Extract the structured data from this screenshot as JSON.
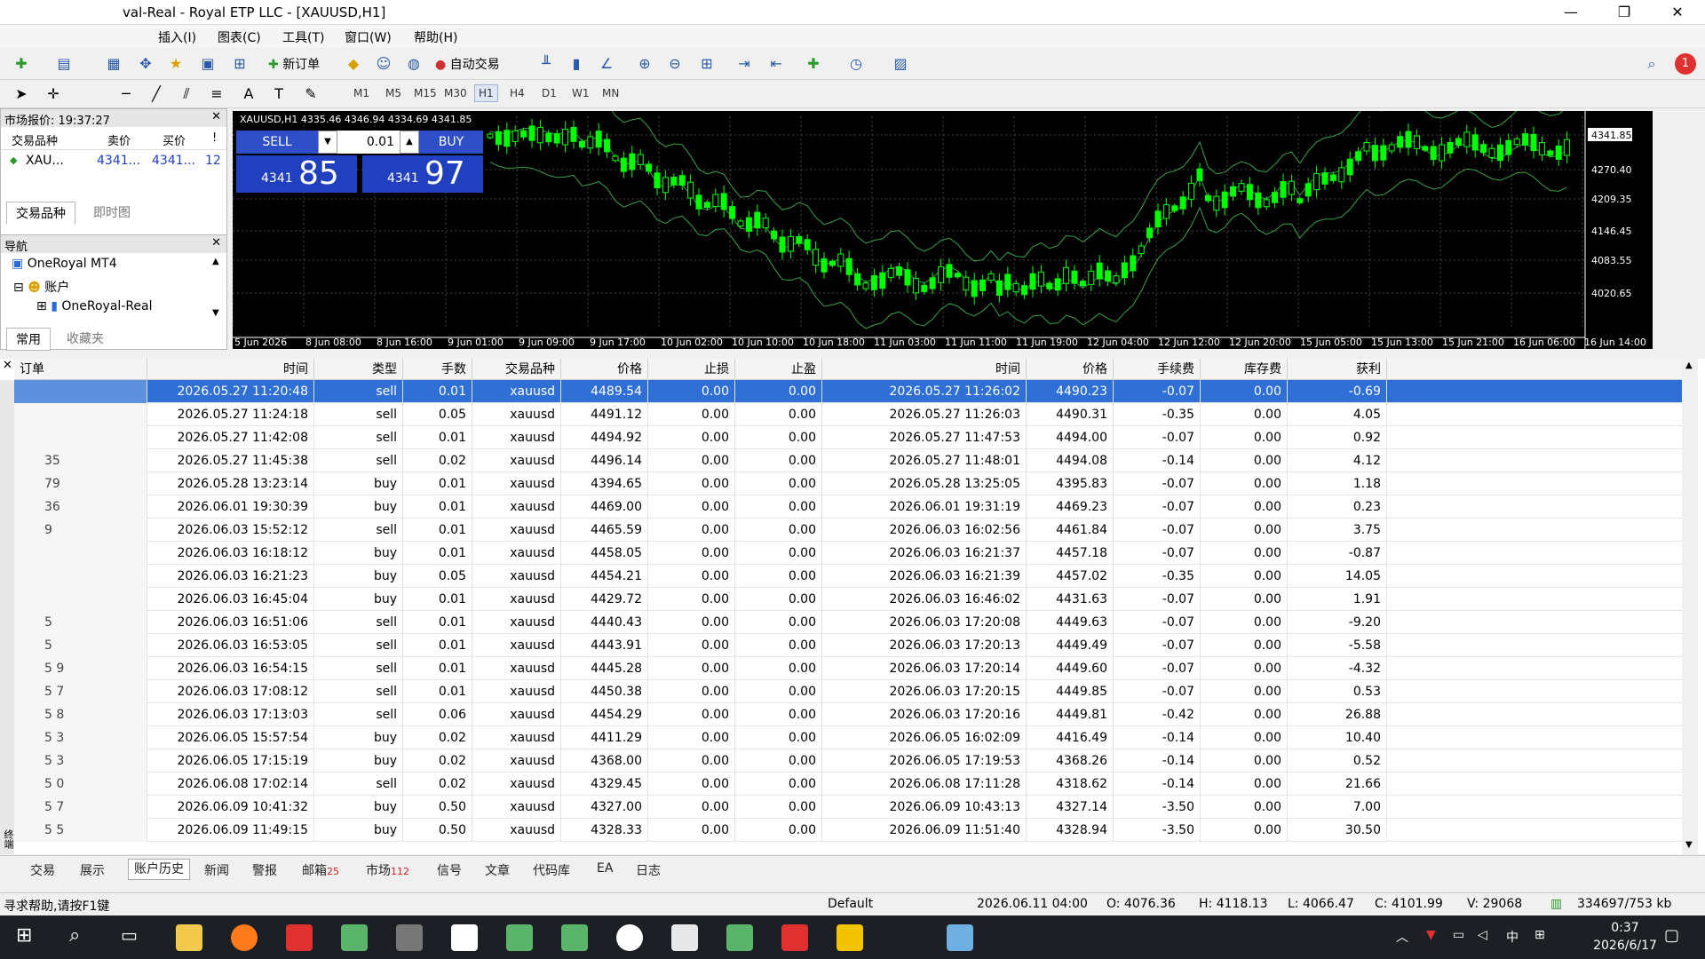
{
  "window": {
    "title": "val-Real - Royal ETP LLC - [XAUUSD,H1]",
    "minimize": "—",
    "restore": "❐",
    "close": "✕"
  },
  "menu": [
    "插入(I)",
    "图表(C)",
    "工具(T)",
    "窗口(W)",
    "帮助(H)"
  ],
  "toolbar": {
    "new_order": "新订单",
    "auto_trade": "自动交易"
  },
  "timeframes": [
    "M1",
    "M5",
    "M15",
    "M30",
    "H1",
    "H4",
    "D1",
    "W1",
    "MN"
  ],
  "selected_timeframe": "H1",
  "market_watch": {
    "title": "市场报价: 19:37:27",
    "cols": [
      "交易品种",
      "卖价",
      "买价",
      "!"
    ],
    "row": {
      "symbol": "XAU...",
      "bid": "4341...",
      "ask": "4341...",
      "spread": "12"
    },
    "tabs": [
      "交易品种",
      "即时图"
    ]
  },
  "navigator": {
    "title": "导航",
    "items": [
      "OneRoyal MT4",
      "账户",
      "OneRoyal-Real"
    ],
    "tabs": [
      "常用",
      "收藏夹"
    ]
  },
  "chart": {
    "info": "XAUUSD,H1  4335.46 4346.94 4334.69 4341.85",
    "sell_label": "SELL",
    "buy_label": "BUY",
    "lot": "0.01",
    "sell_small": "4341",
    "sell_big": "85",
    "buy_small": "4341",
    "buy_big": "97",
    "price_ticks": [
      "4341.85",
      "4270.40",
      "4209.35",
      "4146.45",
      "4083.55",
      "4020.65"
    ],
    "time_ticks": [
      "5 Jun 2026",
      "8 Jun 08:00",
      "8 Jun 16:00",
      "9 Jun 01:00",
      "9 Jun 09:00",
      "9 Jun 17:00",
      "10 Jun 02:00",
      "10 Jun 10:00",
      "10 Jun 18:00",
      "11 Jun 03:00",
      "11 Jun 11:00",
      "11 Jun 19:00",
      "12 Jun 04:00",
      "12 Jun 12:00",
      "12 Jun 20:00",
      "15 Jun 05:00",
      "15 Jun 13:00",
      "15 Jun 21:00",
      "16 Jun 06:00",
      "16 Jun 14:00"
    ],
    "up_color": "#00ff00",
    "bg": "#000000"
  },
  "history": {
    "headers": [
      "订单",
      "时间",
      "类型",
      "手数",
      "交易品种",
      "价格",
      "止损",
      "止盈",
      "时间",
      "价格",
      "手续费",
      "库存费",
      "获利"
    ],
    "rows": [
      [
        "",
        "2026.05.27 11:20:48",
        "sell",
        "0.01",
        "xauusd",
        "4489.54",
        "0.00",
        "0.00",
        "2026.05.27 11:26:02",
        "4490.23",
        "-0.07",
        "0.00",
        "-0.69"
      ],
      [
        "",
        "2026.05.27 11:24:18",
        "sell",
        "0.05",
        "xauusd",
        "4491.12",
        "0.00",
        "0.00",
        "2026.05.27 11:26:03",
        "4490.31",
        "-0.35",
        "0.00",
        "4.05"
      ],
      [
        "",
        "2026.05.27 11:42:08",
        "sell",
        "0.01",
        "xauusd",
        "4494.92",
        "0.00",
        "0.00",
        "2026.05.27 11:47:53",
        "4494.00",
        "-0.07",
        "0.00",
        "0.92"
      ],
      [
        "35",
        "2026.05.27 11:45:38",
        "sell",
        "0.02",
        "xauusd",
        "4496.14",
        "0.00",
        "0.00",
        "2026.05.27 11:48:01",
        "4494.08",
        "-0.14",
        "0.00",
        "4.12"
      ],
      [
        "79",
        "2026.05.28 13:23:14",
        "buy",
        "0.01",
        "xauusd",
        "4394.65",
        "0.00",
        "0.00",
        "2026.05.28 13:25:05",
        "4395.83",
        "-0.07",
        "0.00",
        "1.18"
      ],
      [
        "36",
        "2026.06.01 19:30:39",
        "buy",
        "0.01",
        "xauusd",
        "4469.00",
        "0.00",
        "0.00",
        "2026.06.01 19:31:19",
        "4469.23",
        "-0.07",
        "0.00",
        "0.23"
      ],
      [
        "9",
        "2026.06.03 15:52:12",
        "sell",
        "0.01",
        "xauusd",
        "4465.59",
        "0.00",
        "0.00",
        "2026.06.03 16:02:56",
        "4461.84",
        "-0.07",
        "0.00",
        "3.75"
      ],
      [
        "",
        "2026.06.03 16:18:12",
        "buy",
        "0.01",
        "xauusd",
        "4458.05",
        "0.00",
        "0.00",
        "2026.06.03 16:21:37",
        "4457.18",
        "-0.07",
        "0.00",
        "-0.87"
      ],
      [
        "",
        "2026.06.03 16:21:23",
        "buy",
        "0.05",
        "xauusd",
        "4454.21",
        "0.00",
        "0.00",
        "2026.06.03 16:21:39",
        "4457.02",
        "-0.35",
        "0.00",
        "14.05"
      ],
      [
        "",
        "2026.06.03 16:45:04",
        "buy",
        "0.01",
        "xauusd",
        "4429.72",
        "0.00",
        "0.00",
        "2026.06.03 16:46:02",
        "4431.63",
        "-0.07",
        "0.00",
        "1.91"
      ],
      [
        "5",
        "2026.06.03 16:51:06",
        "sell",
        "0.01",
        "xauusd",
        "4440.43",
        "0.00",
        "0.00",
        "2026.06.03 17:20:08",
        "4449.63",
        "-0.07",
        "0.00",
        "-9.20"
      ],
      [
        "5",
        "2026.06.03 16:53:05",
        "sell",
        "0.01",
        "xauusd",
        "4443.91",
        "0.00",
        "0.00",
        "2026.06.03 17:20:13",
        "4449.49",
        "-0.07",
        "0.00",
        "-5.58"
      ],
      [
        "5 9",
        "2026.06.03 16:54:15",
        "sell",
        "0.01",
        "xauusd",
        "4445.28",
        "0.00",
        "0.00",
        "2026.06.03 17:20:14",
        "4449.60",
        "-0.07",
        "0.00",
        "-4.32"
      ],
      [
        "5 7",
        "2026.06.03 17:08:12",
        "sell",
        "0.01",
        "xauusd",
        "4450.38",
        "0.00",
        "0.00",
        "2026.06.03 17:20:15",
        "4449.85",
        "-0.07",
        "0.00",
        "0.53"
      ],
      [
        "5 8",
        "2026.06.03 17:13:03",
        "sell",
        "0.06",
        "xauusd",
        "4454.29",
        "0.00",
        "0.00",
        "2026.06.03 17:20:16",
        "4449.81",
        "-0.42",
        "0.00",
        "26.88"
      ],
      [
        "5 3",
        "2026.06.05 15:57:54",
        "buy",
        "0.02",
        "xauusd",
        "4411.29",
        "0.00",
        "0.00",
        "2026.06.05 16:02:09",
        "4416.49",
        "-0.14",
        "0.00",
        "10.40"
      ],
      [
        "5 3",
        "2026.06.05 17:15:19",
        "buy",
        "0.02",
        "xauusd",
        "4368.00",
        "0.00",
        "0.00",
        "2026.06.05 17:19:53",
        "4368.26",
        "-0.14",
        "0.00",
        "0.52"
      ],
      [
        "5 0",
        "2026.06.08 17:02:14",
        "sell",
        "0.02",
        "xauusd",
        "4329.45",
        "0.00",
        "0.00",
        "2026.06.08 17:11:28",
        "4318.62",
        "-0.14",
        "0.00",
        "21.66"
      ],
      [
        "5 7",
        "2026.06.09 10:41:32",
        "buy",
        "0.50",
        "xauusd",
        "4327.00",
        "0.00",
        "0.00",
        "2026.06.09 10:43:13",
        "4327.14",
        "-3.50",
        "0.00",
        "7.00"
      ],
      [
        "5 5",
        "2026.06.09 11:49:15",
        "buy",
        "0.50",
        "xauusd",
        "4328.33",
        "0.00",
        "0.00",
        "2026.06.09 11:51:40",
        "4328.94",
        "-3.50",
        "0.00",
        "30.50"
      ]
    ]
  },
  "bottom_tabs": [
    "交易",
    "展示",
    "账户历史",
    "新闻",
    "警报",
    "邮箱",
    "市场",
    "信号",
    "文章",
    "代码库",
    "EA",
    "日志"
  ],
  "mail_badge": "25",
  "market_badge": "112",
  "side_label": "终端",
  "status": {
    "help": "寻求帮助,请按F1键",
    "profile": "Default",
    "date": "2026.06.11 04:00",
    "open": "O: 4076.36",
    "high": "H: 4118.13",
    "low": "L: 4066.47",
    "close": "C: 4101.99",
    "volume": "V: 29068",
    "traffic": "334697/753 kb"
  },
  "taskbar": {
    "time": "0:37",
    "date": "2026/6/17",
    "ime": "中"
  }
}
